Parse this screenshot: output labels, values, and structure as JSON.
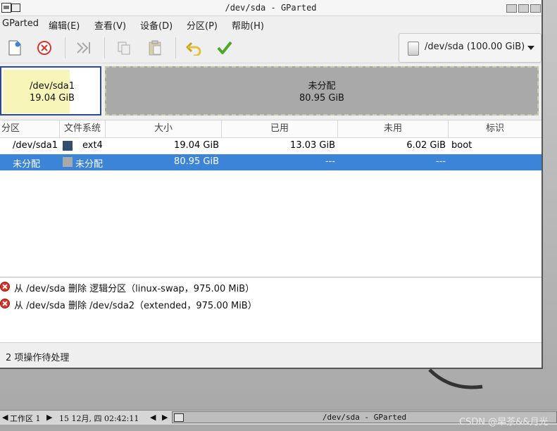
{
  "window": {
    "title": "/dev/sda - GParted"
  },
  "menu": [
    "GParted",
    "编辑(E)",
    "查看(V)",
    "设备(D)",
    "分区(P)",
    "帮助(H)"
  ],
  "device_selector": {
    "label": "/dev/sda (100.00 GiB)"
  },
  "disk_map": {
    "part1": {
      "name": "/dev/sda1",
      "size": "19.04 GiB"
    },
    "part2": {
      "name": "未分配",
      "size": "80.95 GiB"
    }
  },
  "table": {
    "headers": [
      "分区",
      "文件系统",
      "大小",
      "已用",
      "未用",
      "标识"
    ],
    "rows": [
      {
        "partition": "/dev/sda1",
        "fs": "ext4",
        "fs_color": "#314e6c",
        "size": "19.04 GiB",
        "used": "13.03 GiB",
        "unused": "6.02 GiB",
        "flags": "boot",
        "selected": false
      },
      {
        "partition": "未分配",
        "fs": "未分配",
        "fs_color": "#a9a9a9",
        "size": "80.95 GiB",
        "used": "---",
        "unused": "---",
        "flags": "",
        "selected": true
      }
    ]
  },
  "operations": [
    "从 /dev/sda 删除 逻辑分区（linux-swap，975.00 MiB）",
    "从 /dev/sda 删除 /dev/sda2（extended，975.00 MiB）"
  ],
  "status": "2 项操作待处理",
  "taskbar": {
    "workspace": "工作区 1",
    "clock": "15 12月, 四 02:42:11",
    "task_title": "/dev/sda - GParted",
    "watermark": "CSDN @早茶&&月光"
  },
  "colors": {
    "selection": "#3b84d8",
    "unallocated": "#a9a9a9",
    "ext4": "#314e6c",
    "used_fill": "#f7f6b8"
  }
}
